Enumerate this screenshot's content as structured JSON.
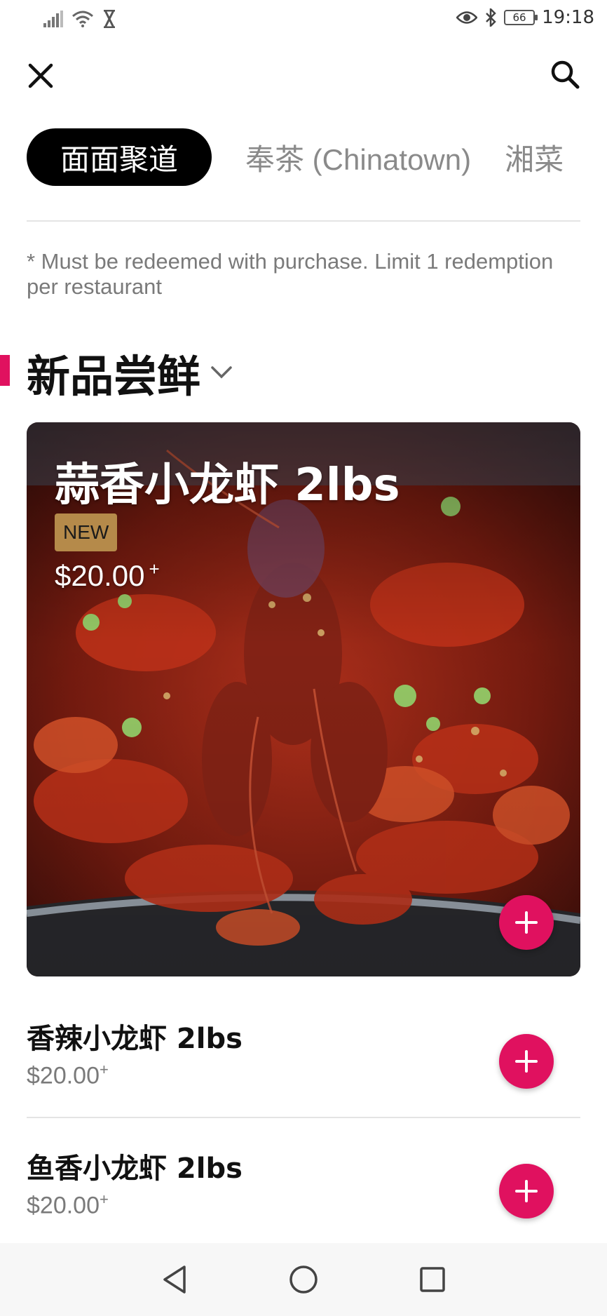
{
  "status_bar": {
    "time": "19:18",
    "battery": "66",
    "icons": [
      "signal-icon",
      "wifi-icon",
      "hourglass-icon",
      "eye-icon",
      "bluetooth-icon",
      "battery-icon"
    ]
  },
  "header": {
    "close_icon": "close-icon",
    "search_icon": "search-icon"
  },
  "tabs": [
    {
      "label": "面面聚道",
      "active": true
    },
    {
      "label": "奉茶 (Chinatown)",
      "active": false
    },
    {
      "label": "湘菜",
      "active": false
    }
  ],
  "note": "* Must be redeemed with purchase. Limit 1 redemption per restaurant",
  "section": {
    "title": "新品尝鲜"
  },
  "featured": {
    "name": "蒜香小龙虾 2lbs",
    "badge": "NEW",
    "price": "$20.00",
    "price_suffix": "+"
  },
  "items": [
    {
      "name": "香辣小龙虾 2lbs",
      "price": "$20.00",
      "price_suffix": "+"
    },
    {
      "name": "鱼香小龙虾 2lbs",
      "price": "$20.00",
      "price_suffix": "+"
    }
  ],
  "colors": {
    "accent": "#e0115f",
    "badge": "#b58a4a",
    "muted_text": "#7a7a7a"
  }
}
